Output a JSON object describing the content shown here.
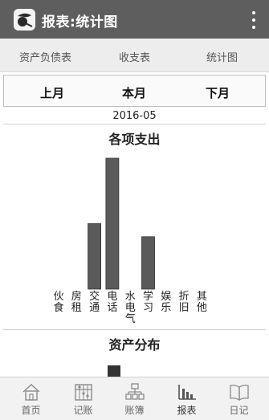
{
  "app": {
    "title": "报表:统计图"
  },
  "tabs": [
    {
      "label": "资产负债表"
    },
    {
      "label": "收支表"
    },
    {
      "label": "统计图"
    }
  ],
  "months": {
    "prev": "上月",
    "current": "本月",
    "next": "下月"
  },
  "date": "2016-05",
  "chart_data": {
    "type": "bar",
    "title": "各项支出",
    "categories": [
      "伙食",
      "房租",
      "交通",
      "电话",
      "水电气",
      "学习",
      "娱乐",
      "折旧",
      "其他"
    ],
    "values": [
      0,
      0,
      50,
      100,
      0,
      40,
      0,
      0,
      0
    ],
    "xlabel": "",
    "ylabel": "",
    "ylim": [
      0,
      100
    ],
    "grid": false,
    "bar_color": "#5a5a5a"
  },
  "asset_section": {
    "title": "资产分布"
  },
  "bottom_nav": [
    {
      "label": "首页",
      "icon": "home-icon"
    },
    {
      "label": "记账",
      "icon": "abacus-icon"
    },
    {
      "label": "账簿",
      "icon": "ledger-tree-icon"
    },
    {
      "label": "报表",
      "icon": "bar-chart-icon"
    },
    {
      "label": "日记",
      "icon": "book-icon"
    }
  ],
  "colors": {
    "header": "#5e5e5e",
    "tabbar": "#ededed",
    "bar": "#5a5a5a"
  }
}
